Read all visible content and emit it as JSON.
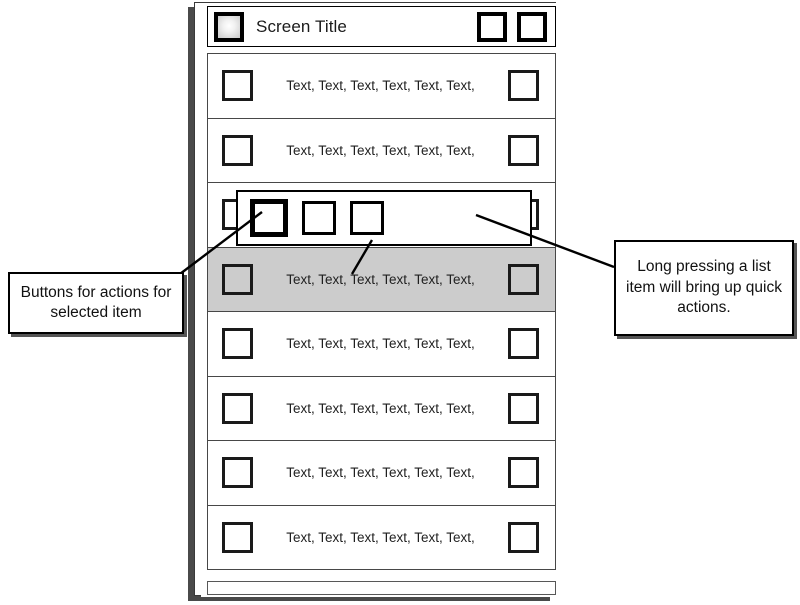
{
  "screen": {
    "title": "Screen Title",
    "title_icon": "app-icon",
    "title_buttons": [
      {
        "name": "title-action-1",
        "icon": "square-button-icon"
      },
      {
        "name": "title-action-2",
        "icon": "square-button-icon"
      }
    ]
  },
  "list": {
    "row_text": "Text, Text, Text, Text, Text, Text,",
    "rows": [
      {
        "text": "Text, Text, Text, Text, Text, Text,",
        "selected": false,
        "text_visible": true
      },
      {
        "text": "Text, Text, Text, Text, Text, Text,",
        "selected": false,
        "text_visible": true
      },
      {
        "text": "",
        "selected": false,
        "text_visible": false
      },
      {
        "text": "Text, Text, Text, Text, Text, Text,",
        "selected": true,
        "text_visible": true
      },
      {
        "text": "Text, Text, Text, Text, Text, Text,",
        "selected": false,
        "text_visible": true
      },
      {
        "text": "Text, Text, Text, Text, Text, Text,",
        "selected": false,
        "text_visible": true
      },
      {
        "text": "Text, Text, Text, Text, Text, Text,",
        "selected": false,
        "text_visible": true
      },
      {
        "text": "Text, Text, Text, Text, Text, Text,",
        "selected": false,
        "text_visible": true
      }
    ],
    "left_checkbox_icon": "checkbox-icon",
    "right_checkbox_icon": "checkbox-icon"
  },
  "quick_actions": {
    "buttons": [
      {
        "name": "quick-action-1",
        "icon": "square-button-icon",
        "primary": true
      },
      {
        "name": "quick-action-2",
        "icon": "square-button-icon",
        "primary": false
      },
      {
        "name": "quick-action-3",
        "icon": "square-button-icon",
        "primary": false
      }
    ]
  },
  "annotations": {
    "left": "Buttons for actions for selected item",
    "right": "Long pressing a list item will bring up quick actions."
  },
  "colors": {
    "selected_row": "#cccccc",
    "outline": "#000000",
    "frame_shadow": "#4a4a4a",
    "page_background": "#ffffff"
  }
}
